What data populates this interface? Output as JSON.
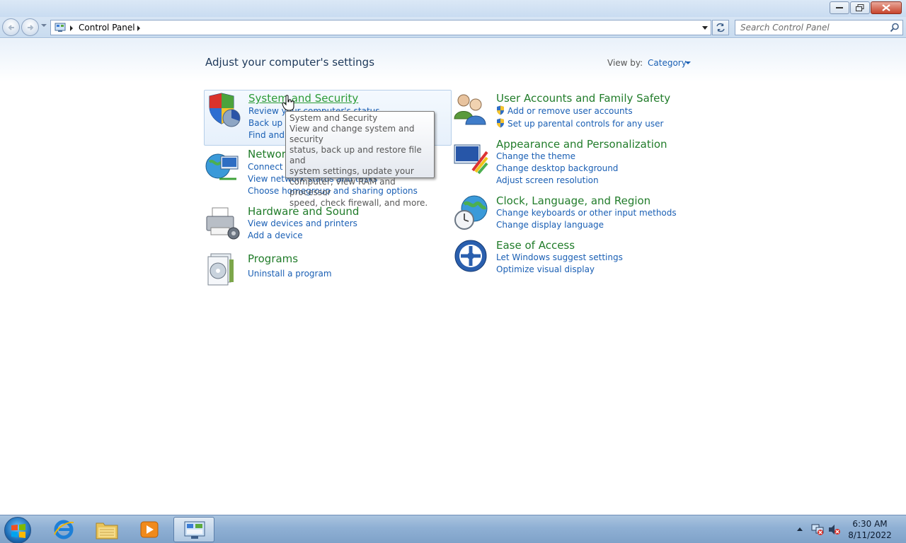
{
  "address": {
    "path": "Control Panel"
  },
  "search": {
    "placeholder": "Search Control Panel"
  },
  "page": {
    "heading": "Adjust your computer's settings",
    "view_by_label": "View by:",
    "view_by_value": "Category"
  },
  "categories": [
    {
      "title": "System and Security",
      "icon": "shield-icon",
      "links": [
        "Review your computer's status",
        "Back up your computer",
        "Find and fix problems"
      ]
    },
    {
      "title": "Network and Internet",
      "icon": "network-globe-icon",
      "links": [
        "Connect to the Internet",
        "View network status and tasks",
        "Choose homegroup and sharing options"
      ]
    },
    {
      "title": "Hardware and Sound",
      "icon": "printer-icon",
      "links": [
        "View devices and printers",
        "Add a device"
      ]
    },
    {
      "title": "Programs",
      "icon": "programs-icon",
      "links": [
        "Uninstall a program"
      ]
    },
    {
      "title": "User Accounts and Family Safety",
      "icon": "users-icon",
      "links": [
        "Add or remove user accounts",
        "Set up parental controls for any user"
      ]
    },
    {
      "title": "Appearance and Personalization",
      "icon": "monitor-paint-icon",
      "links": [
        "Change the theme",
        "Change desktop background",
        "Adjust screen resolution"
      ]
    },
    {
      "title": "Clock, Language, and Region",
      "icon": "clock-globe-icon",
      "links": [
        "Change keyboards or other input methods",
        "Change display language"
      ]
    },
    {
      "title": "Ease of Access",
      "icon": "ease-of-access-icon",
      "links": [
        "Let Windows suggest settings",
        "Optimize visual display"
      ]
    }
  ],
  "tooltip": {
    "title": "System and Security",
    "lines": [
      "View and change system and security",
      "status, back up and restore file and",
      "system settings, update your",
      "computer, view RAM and processor",
      "speed, check firewall, and more."
    ]
  },
  "taskbar": {
    "items": [
      "internet-explorer-icon",
      "file-explorer-icon",
      "media-player-icon",
      "control-panel-icon"
    ],
    "time": "6:30 AM",
    "date": "8/11/2022"
  }
}
